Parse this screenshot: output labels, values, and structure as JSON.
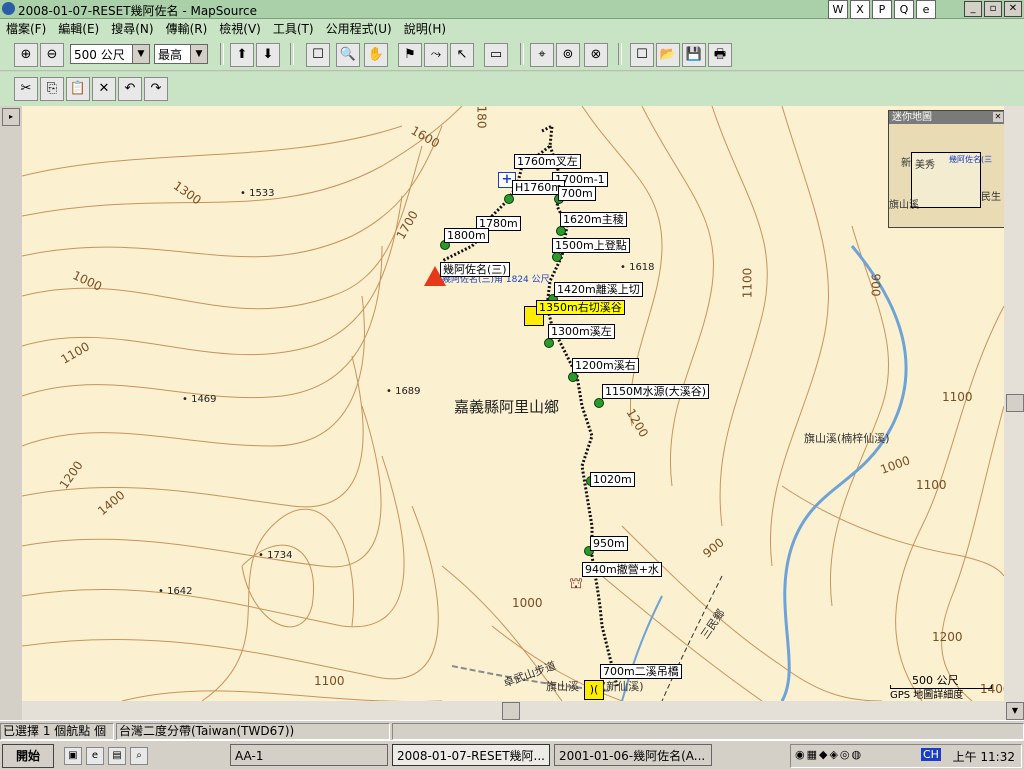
{
  "window": {
    "title": "2008-01-07-RESET幾阿佐名 - MapSource",
    "taskbar_apps": [
      "W",
      "X",
      "P",
      "Q",
      "e"
    ],
    "win_buttons": [
      "_",
      "▫",
      "✕"
    ]
  },
  "menu": [
    "檔案(F)",
    "編輯(E)",
    "搜尋(N)",
    "傳輸(R)",
    "檢視(V)",
    "工具(T)",
    "公用程式(U)",
    "說明(H)"
  ],
  "toolbar": {
    "zoom_in": "⊕",
    "zoom_out": "⊖",
    "scale_value": "500 公尺",
    "detail_value": "最高",
    "tools": [
      "⬆",
      "⬇",
      "☐",
      "🔍",
      "✋",
      "⚑",
      "⤳",
      "↖",
      "▭",
      "⌖",
      "⊚",
      "⊗",
      "☐",
      "📂",
      "💾",
      "🖶"
    ],
    "edit_tools": [
      "✂",
      "⎘",
      "📋",
      "✕",
      "↶",
      "↷"
    ]
  },
  "map": {
    "region_label": "嘉義縣阿里山鄉",
    "river_label": "旗山溪(楠梓仙溪)",
    "road_label": "卓武山步道",
    "county_line_label": "三民鄉",
    "scale_label": "500 公尺",
    "detail_label": "GPS 地圖詳細度",
    "summit_label": "幾阿佐名(三)角 1824 公尺",
    "contours": [
      {
        "t": "1600"
      },
      {
        "t": "1300"
      },
      {
        "t": "1700"
      },
      {
        "t": "1000"
      },
      {
        "t": "1100"
      },
      {
        "t": "1200"
      },
      {
        "t": "1400"
      },
      {
        "t": "1100"
      },
      {
        "t": "1000"
      },
      {
        "t": "1100"
      },
      {
        "t": "1200"
      },
      {
        "t": "900"
      },
      {
        "t": "1000"
      },
      {
        "t": "1100"
      },
      {
        "t": "1200"
      },
      {
        "t": "1100"
      },
      {
        "t": "1400"
      },
      {
        "t": "180"
      },
      {
        "t": "900"
      }
    ],
    "peaks": [
      "1533",
      "1618",
      "1469",
      "1689",
      "1734",
      "1642"
    ],
    "waypoints": [
      "1760m叉左",
      "1700m-1",
      "H1760m",
      "700m",
      "1780m",
      "1620m主稜",
      "1800m",
      "1500m上登點",
      "幾阿佐名(三)",
      "1420m離溪上切",
      "1350m右切溪谷",
      "1300m溪左",
      "1200m溪右",
      "1150M水源(大溪谷)",
      "1020m",
      "950m",
      "940m撤營+水",
      "700m二溪吊橋",
      "旗山溪",
      "(新仙溪)"
    ],
    "minimap": {
      "title": "迷你地圖",
      "labels": [
        "美秀",
        "新",
        "幾阿佐名(三",
        "民生",
        "旗山溪"
      ]
    }
  },
  "status": {
    "selection": "已選擇 1 個航點 個",
    "datum": "台灣二度分帶(Taiwan(TWD67))"
  },
  "taskbar": {
    "start": "開始",
    "buttons": [
      "AA-1",
      "2008-01-07-RESET幾阿...",
      "2001-01-06-幾阿佐名(A..."
    ],
    "clock": "上午 11:32",
    "tray_text": "CH"
  }
}
